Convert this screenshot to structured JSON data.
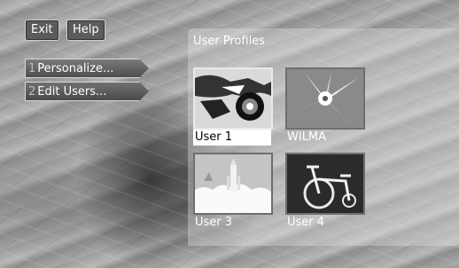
{
  "header": {
    "exit_label": "Exit",
    "help_label": "Help"
  },
  "menu": {
    "items": [
      {
        "number": "1",
        "label": "Personalize..."
      },
      {
        "number": "2",
        "label": "Edit Users..."
      }
    ]
  },
  "panel": {
    "title": "User Profiles"
  },
  "users": [
    {
      "name": "User 1",
      "image": "motorcycle"
    },
    {
      "name": "WILMA",
      "image": "flower"
    },
    {
      "name": "User 3",
      "image": "rocket-launch"
    },
    {
      "name": "User 4",
      "image": "tricycle"
    }
  ]
}
